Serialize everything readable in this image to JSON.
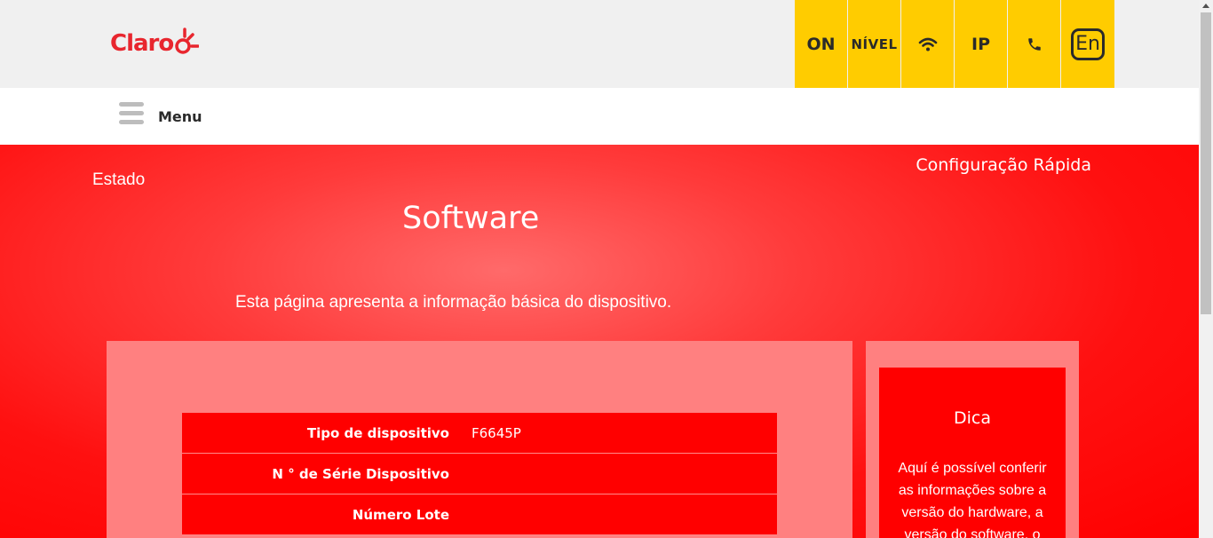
{
  "header": {
    "logo_text": "Claro",
    "quick_icons": [
      {
        "label": "ON",
        "icon": "power-on-text"
      },
      {
        "label": "NÍVEL",
        "icon": "signal-level-text"
      },
      {
        "label": "",
        "icon": "wifi-icon"
      },
      {
        "label": "IP",
        "icon": "ip-text"
      },
      {
        "label": "",
        "icon": "phone-icon"
      },
      {
        "label": "En",
        "icon": "language-icon"
      }
    ]
  },
  "menubar": {
    "menu_label": "Menu"
  },
  "main": {
    "breadcrumb": "Estado",
    "quick_config": "Configuração Rápida",
    "title": "Software",
    "description": "Esta página apresenta a informação básica do dispositivo.",
    "rows": [
      {
        "label": "Tipo de dispositivo",
        "value": "F6645P"
      },
      {
        "label": "N ° de Série Dispositivo",
        "value": ""
      },
      {
        "label": "Número Lote",
        "value": ""
      }
    ]
  },
  "tip": {
    "title": "Dica",
    "text": "Aquí é possível conferir as informações sobre a versão do hardware, a versão do software, o"
  },
  "colors": {
    "brand_red": "#ff0000",
    "accent_yellow": "#ffcc00",
    "panel_pink": "#ff8080",
    "logo_red": "#e8262e"
  }
}
